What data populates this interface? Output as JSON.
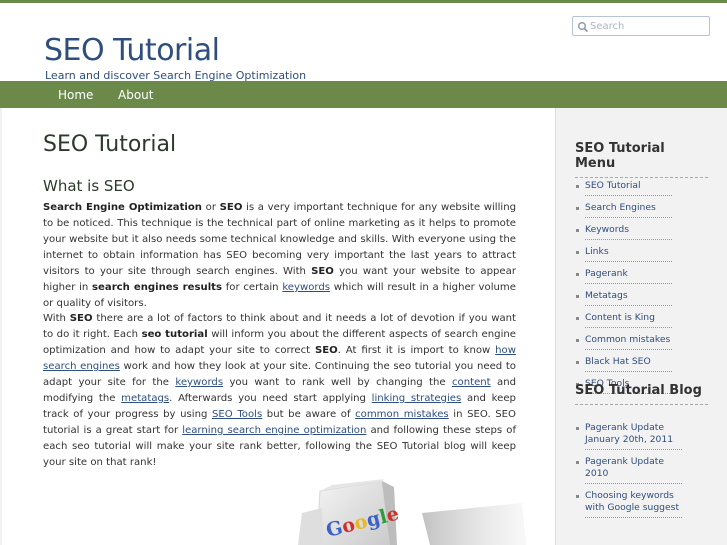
{
  "header": {
    "title": "SEO Tutorial",
    "tagline": "Learn and discover Search Engine Optimization"
  },
  "search": {
    "placeholder": "Search"
  },
  "nav": {
    "items": [
      "Home",
      "About"
    ]
  },
  "main": {
    "page_title": "SEO Tutorial",
    "section_title": "What is SEO",
    "p1": {
      "b1": "Search Engine Optimization",
      "t1": " or ",
      "b2": "SEO",
      "t2": " is a very important technique for any website willing to be noticed. This technique is the technical part of online marketing as it helps to promote your website but it also needs some technical knowledge and skills. With everyone using the internet to obtain information has SEO becoming very important the last years to attract visitors to your site through search engines. With ",
      "b3": "SEO",
      "t3": " you want your website to appear higher in ",
      "b4": "search engines results",
      "t4": " for certain ",
      "l1": "keywords",
      "t5": " which will result in a higher volume or quality of visitors."
    },
    "p2": {
      "t1": "With ",
      "b1": "SEO",
      "t2": " there are a lot of factors to think about and it needs a lot of devotion if you want to do it right. Each ",
      "b2": "seo tutorial",
      "t3": " will inform you about the different aspects of search engine optimization and how to adapt your site to correct ",
      "b3": "SEO",
      "t4": ". At first it is import to know ",
      "l1": "how search engines",
      "t5": " work and how they look at your site. Continuing the seo tutorial you need to adapt your site for the ",
      "l2": "keywords",
      "t6": " you want to rank well by changing the ",
      "l3": "content",
      "t7": " and modifying the ",
      "l4": "metatags",
      "t8": ". Afterwards you need start applying ",
      "l5": "linking strategies",
      "t9": " and keep track of your progress by using ",
      "l6": "SEO Tools",
      "t10": " but be aware of ",
      "l7": "common mistakes",
      "t11": " in SEO. SEO tutorial is a great start for ",
      "l8": "learning search engine optimization",
      "t12": " and following these steps of each seo tutorial will make your site rank better, following the SEO Tutorial blog will keep your site on that rank!"
    },
    "illustration_text": "Google"
  },
  "sidebar": {
    "menu_title": "SEO Tutorial Menu",
    "menu_items": [
      "SEO Tutorial",
      "Search Engines",
      "Keywords",
      "Links",
      "Pagerank",
      "Metatags",
      "Content is King",
      "Common mistakes",
      "Black Hat SEO",
      "SEO Tools"
    ],
    "blog_title": "SEO Tutorial Blog",
    "blog_items": [
      "Pagerank Update January 20th, 2011",
      "Pagerank Update 2010",
      "Choosing keywords with Google suggest"
    ]
  }
}
